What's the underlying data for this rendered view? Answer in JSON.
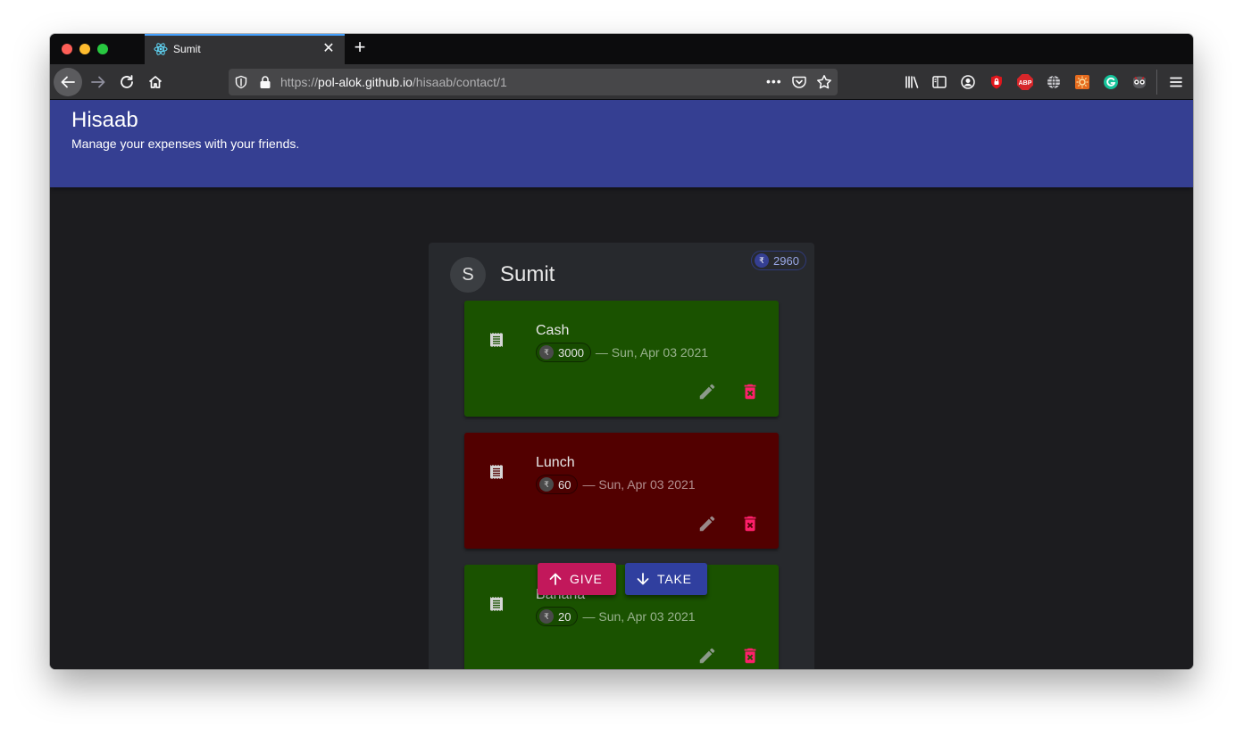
{
  "browser": {
    "tab_title": "Sumit",
    "new_tab_symbol": "+",
    "tab_close_symbol": "✕",
    "url_scheme": "https://",
    "url_host": "pol-alok.github.io",
    "url_path": "/hisaab/contact/1",
    "url_more": "•••",
    "toolbar_icons": [
      "library-icon",
      "sidebar-icon",
      "account-icon",
      "privacy-badger-icon",
      "adblock-plus-icon",
      "globe-icon",
      "extension-sun-icon",
      "grammarly-icon",
      "extension-glasses-icon",
      "menu-icon"
    ],
    "adblock_label": "ABP"
  },
  "app": {
    "title": "Hisaab",
    "subtitle": "Manage your expenses with your friends."
  },
  "contact": {
    "initial": "S",
    "name": "Sumit",
    "currency_symbol": "₹",
    "balance": "2960"
  },
  "entries": [
    {
      "title": "Cash",
      "amount": "3000",
      "date": "— Sun, Apr 03 2021",
      "type": "give",
      "color": "#1a5200"
    },
    {
      "title": "Lunch",
      "amount": "60",
      "date": "— Sun, Apr 03 2021",
      "type": "take",
      "color": "#520000"
    },
    {
      "title": "Banana",
      "amount": "20",
      "date": "— Sun, Apr 03 2021",
      "type": "give",
      "color": "#1a5200"
    }
  ],
  "actions": {
    "give_label": "GIVE",
    "take_label": "TAKE",
    "give_color": "#c2185b",
    "take_color": "#303f9f"
  },
  "colors": {
    "appbar": "#353f92",
    "delete_icon": "#ff1f6b"
  }
}
